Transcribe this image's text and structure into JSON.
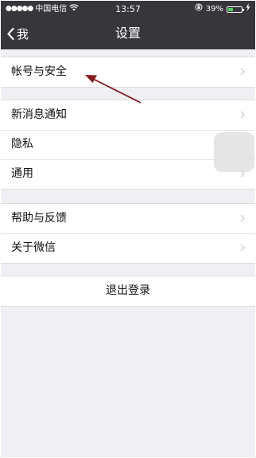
{
  "status_bar": {
    "signal_dots": "●●●●●",
    "carrier": "中国电信",
    "wifi_icon": "wifi-icon",
    "time": "13:57",
    "battery_percent": "39%",
    "battery_level": 0.39,
    "battery_fill_color": "#4cd964",
    "charging_icon": "bolt-icon"
  },
  "nav": {
    "back_label": "我",
    "title": "设置"
  },
  "groups": [
    {
      "items": [
        {
          "label": "帐号与安全"
        }
      ]
    },
    {
      "items": [
        {
          "label": "新消息通知"
        },
        {
          "label": "隐私"
        },
        {
          "label": "通用"
        }
      ]
    },
    {
      "items": [
        {
          "label": "帮助与反馈"
        },
        {
          "label": "关于微信"
        }
      ]
    }
  ],
  "logout_label": "退出登录",
  "colors": {
    "nav_bar": "#37373b",
    "background": "#efeff4",
    "annotation_arrow": "#8b1a1a"
  }
}
